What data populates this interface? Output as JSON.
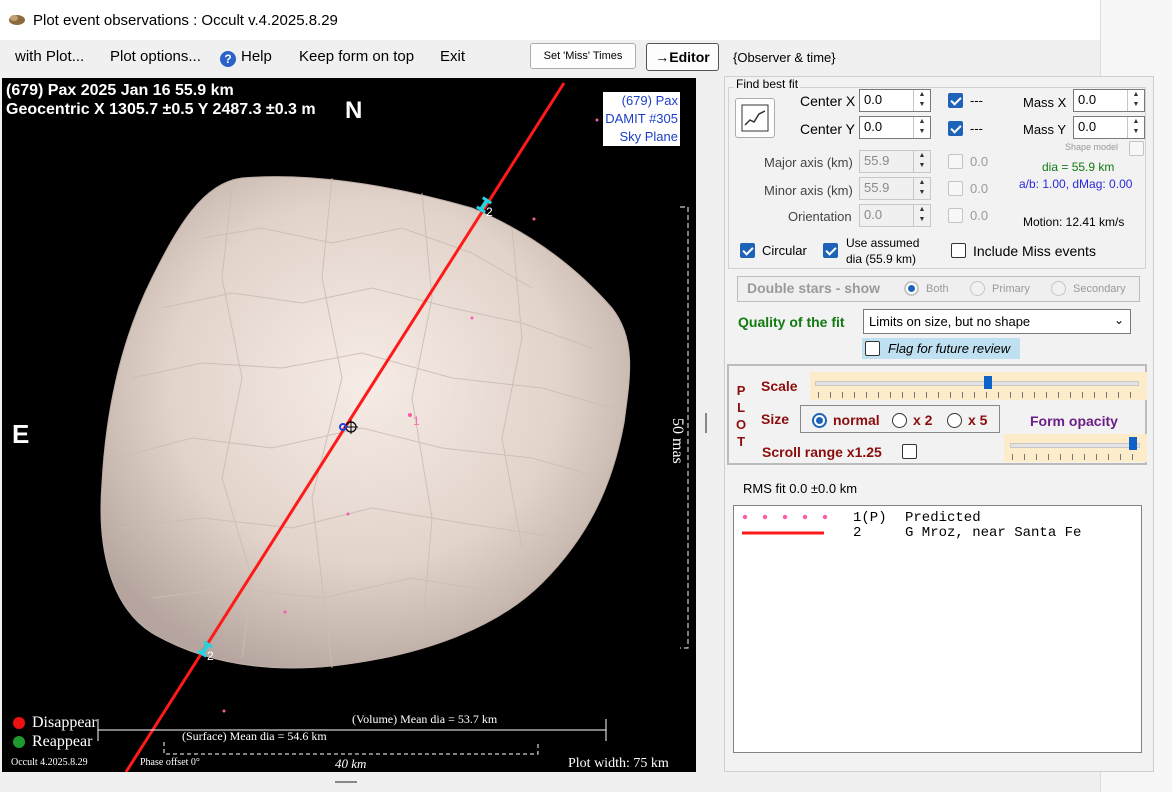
{
  "window": {
    "title": "Plot event observations : Occult v.4.2025.8.29"
  },
  "menu": {
    "with_plot": "with Plot...",
    "plot_options": "Plot options...",
    "help": "Help",
    "keep_on_top": "Keep form on top",
    "exit": "Exit"
  },
  "buttons": {
    "set_miss": "Set 'Miss' Times",
    "editor": "→Editor"
  },
  "observer_time": "{Observer & time}",
  "plot": {
    "header1": "(679) Pax  2025 Jan 16   55.9 km",
    "header2": "Geocentric  X  1305.7 ±0.5  Y 2487.3 ±0.3  m",
    "north": "N",
    "east": "E",
    "info": [
      "(679) Pax",
      "DAMIT #305",
      "Sky Plane"
    ],
    "chord_label_1": "1",
    "chord_label_2a": "2",
    "chord_label_2b": "2",
    "scale_right": "50 mas",
    "volume_dia": "(Volume) Mean dia = 53.7 km",
    "surface_dia": "(Surface) Mean dia = 54.6 km",
    "legend_disappear": "Disappear",
    "legend_reappear": "Reappear",
    "version": "Occult 4.2025.8.29",
    "phase": "Phase offset 0°",
    "scalebar": "40 km",
    "plot_width": "Plot width: 75 km"
  },
  "fit": {
    "group": "Find best fit",
    "center_x_label": "Center X",
    "center_x": "0.0",
    "center_y_label": "Center Y",
    "center_y": "0.0",
    "mass_x_label": "Mass X",
    "mass_x": "0.0",
    "mass_y_label": "Mass Y",
    "mass_y": "0.0",
    "dash": "---",
    "shape_model": "Shape model",
    "major_label": "Major axis (km)",
    "major": "55.9",
    "minor_label": "Minor axis (km)",
    "minor": "55.9",
    "orient_label": "Orientation",
    "orient": "0.0",
    "fixed_major": "0.0",
    "fixed_minor": "0.0",
    "fixed_orient": "0.0",
    "dia_text": "dia = 55.9 km",
    "ab_text": "a/b: 1.00, dMag: 0.00",
    "motion": "Motion: 12.41 km/s",
    "circular": "Circular",
    "use_assumed": "Use assumed",
    "use_assumed2": "dia (55.9 km)",
    "include_miss": "Include Miss events"
  },
  "double_stars": {
    "label": "Double stars - show",
    "both": "Both",
    "primary": "Primary",
    "secondary": "Secondary"
  },
  "quality": {
    "label": "Quality of the fit",
    "value": "Limits on size, but no shape",
    "flag": "Flag for future review"
  },
  "plot_ctrl": {
    "letters": [
      "P",
      "L",
      "O",
      "T"
    ],
    "scale": "Scale",
    "scale_value": 0.5,
    "size": "Size",
    "normal": "normal",
    "x2": "x 2",
    "x5": "x 5",
    "form_opacity": "Form opacity",
    "opacity_value": 1.0,
    "scroll_range": "Scroll range x1.25"
  },
  "rms": "RMS fit 0.0 ±0.0 km",
  "list": [
    {
      "num": "1(P)",
      "name": "Predicted"
    },
    {
      "num": "2",
      "name": "G Mroz, near Santa Fe"
    }
  ],
  "colors": {
    "accent": "#1f63b9",
    "quality_label": "#117a11",
    "dia_text": "#117a11",
    "ab_text": "#2a2ad8",
    "plot_ctrl_label": "#8b0d0d",
    "form_opacity": "#6b1e88",
    "chord_red": "#ff1a1a",
    "marker_cyan": "#26d4e0",
    "disappear": "#ee1111",
    "reappear": "#1e9a2e"
  }
}
